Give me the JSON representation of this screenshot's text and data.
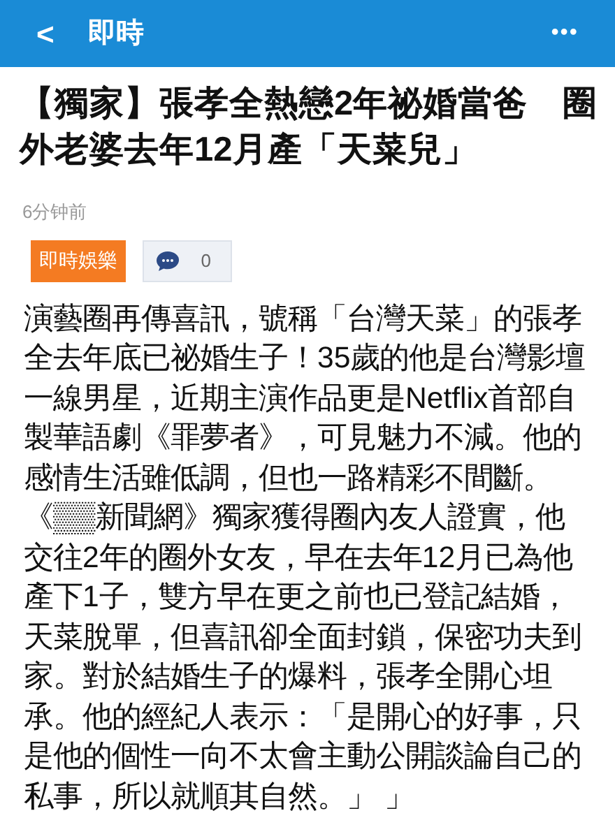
{
  "top_bar": {
    "back": "<",
    "title": "即時",
    "more": "•••"
  },
  "article": {
    "headline": "【獨家】張孝全熱戀2年祕婚當爸　圈外老婆去年12月產「天菜兒」",
    "time": "6分钟前",
    "category": "即時娛樂",
    "comment_count": "0",
    "body": "演藝圈再傳喜訊，號稱「台灣天菜」的張孝全去年底已祕婚生子！35歲的他是台灣影壇一線男星，近期主演作品更是Netflix首部自製華語劇《罪夢者》，可見魅力不減。他的感情生活雖低調，但也一路精彩不間斷。《▒▒新聞網》獨家獲得圈內友人證實，他交往2年的圈外女友，早在去年12月已為他產下1子，雙方早在更之前也已登記結婚，天菜脫單，但喜訊卻全面封鎖，保密功夫到家。對於結婚生子的爆料，張孝全開心坦承。他的經紀人表示：「是開心的好事，只是他的個性一向不太會主動公開談論自己的私事，所以就順其自然。」 」"
  }
}
